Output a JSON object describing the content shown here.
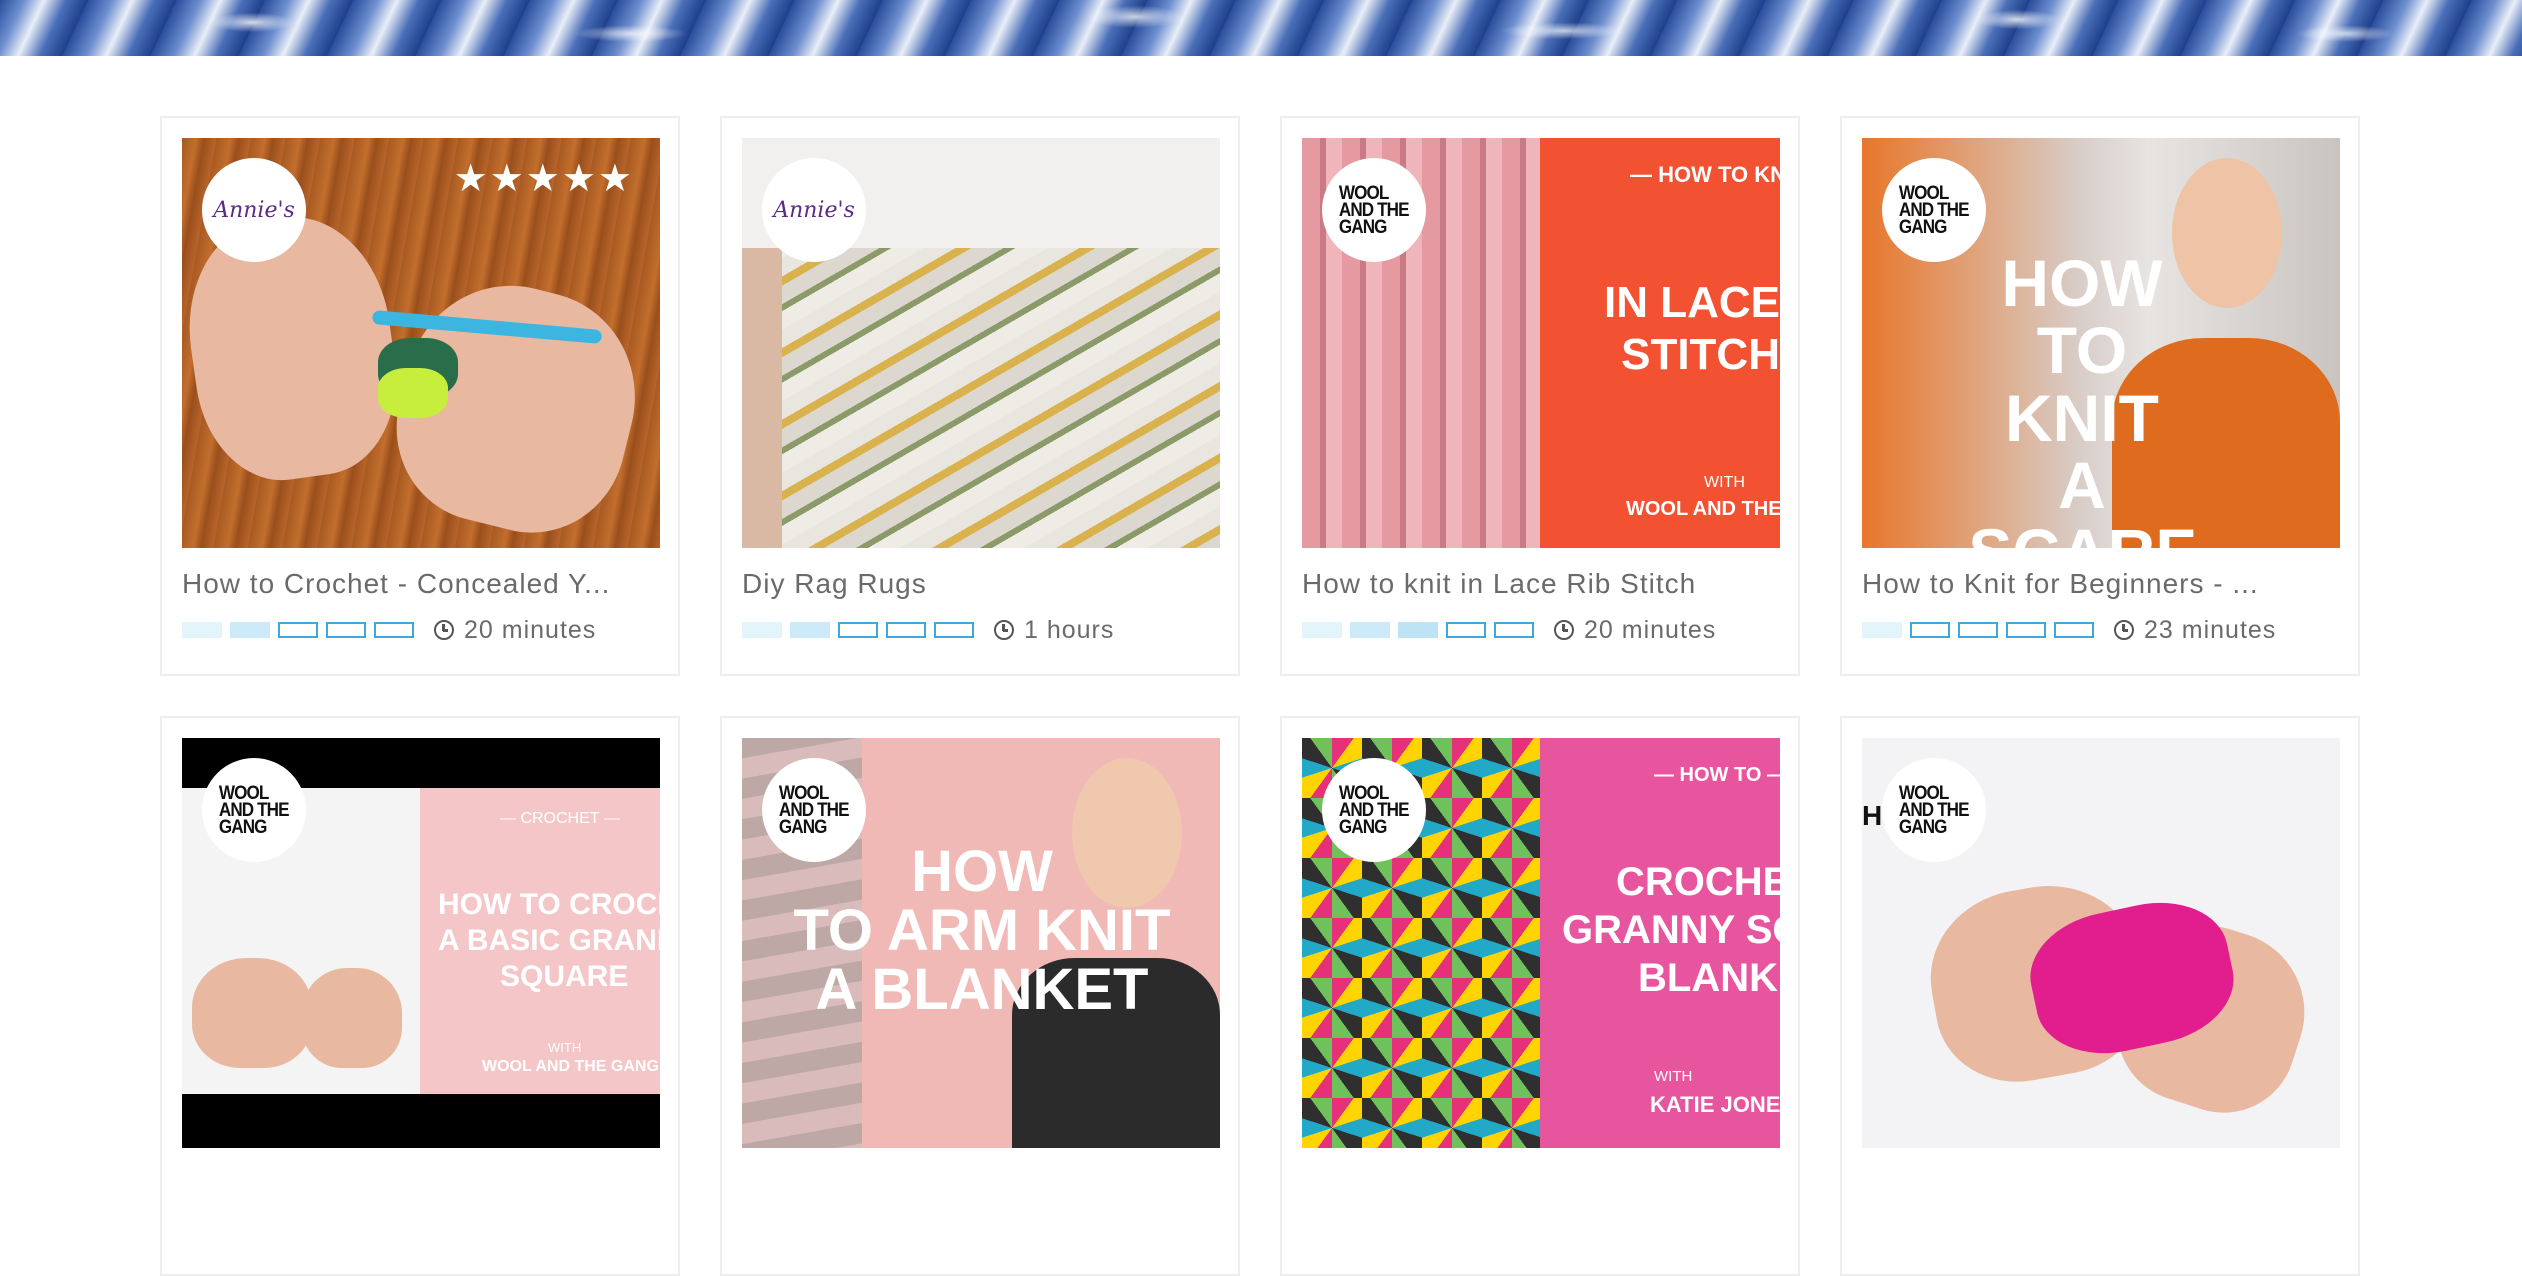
{
  "cards": [
    {
      "title": "How to Crochet - Concealed Y...",
      "duration": "20 minutes",
      "brand": "Annie's",
      "rating_stars": 5,
      "stars_text": "★★★★★",
      "difficulty_filled": 2,
      "difficulty_total": 5,
      "thumb_text": {}
    },
    {
      "title": "Diy Rag Rugs",
      "duration": "1 hours",
      "brand": "Annie's",
      "difficulty_filled": 2,
      "difficulty_total": 5,
      "thumb_text": {}
    },
    {
      "title": "How to knit in Lace Rib Stitch",
      "duration": "20 minutes",
      "brand": "WOOL AND THE GANG",
      "difficulty_filled": 3,
      "difficulty_total": 5,
      "thumb_text": {
        "top": "— HOW TO KNIT",
        "main_1": "IN LACE",
        "main_2": "STITCH",
        "with": "WITH",
        "credit": "WOOL AND THE"
      }
    },
    {
      "title": "How to Knit for Beginners - ...",
      "duration": "23 minutes",
      "brand": "WOOL AND THE GANG",
      "difficulty_filled": 1,
      "difficulty_total": 5,
      "thumb_text": {
        "main_1": "HOW",
        "main_2": "TO KNIT",
        "main_3": "A SCARF"
      }
    },
    {
      "brand": "WOOL AND THE GANG",
      "thumb_text": {
        "top": "— CROCHET —",
        "main_1": "HOW TO CROCHE",
        "main_2": "A BASIC GRANNY",
        "main_3": "SQUARE",
        "with": "WITH",
        "credit": "WOOL AND THE GANG"
      }
    },
    {
      "brand": "WOOL AND THE GANG",
      "thumb_text": {
        "main_1": "HOW",
        "main_2": "TO ARM KNIT",
        "main_3": "A BLANKET"
      }
    },
    {
      "brand": "WOOL AND THE GANG",
      "thumb_text": {
        "top": "— HOW TO —",
        "main_1": "CROCHET",
        "main_2": "GRANNY SQ",
        "main_3": "BLANKE",
        "with": "WITH",
        "credit": "KATIE JONE"
      }
    },
    {
      "brand": "WOOL AND THE GANG",
      "thumb_text": {
        "edge": "HE"
      }
    }
  ],
  "brand_lines": {
    "annies": "Annie's",
    "wool_1": "WOOL",
    "wool_2": "AND THE",
    "wool_3": "GANG"
  },
  "colors": {
    "difficulty_filled": "#cdeaf8",
    "difficulty_empty_border": "#3fa7dd",
    "lace_panel": "#f25232",
    "granny_panel": "#f5c6c8",
    "crochet_panel": "#e6559e"
  }
}
